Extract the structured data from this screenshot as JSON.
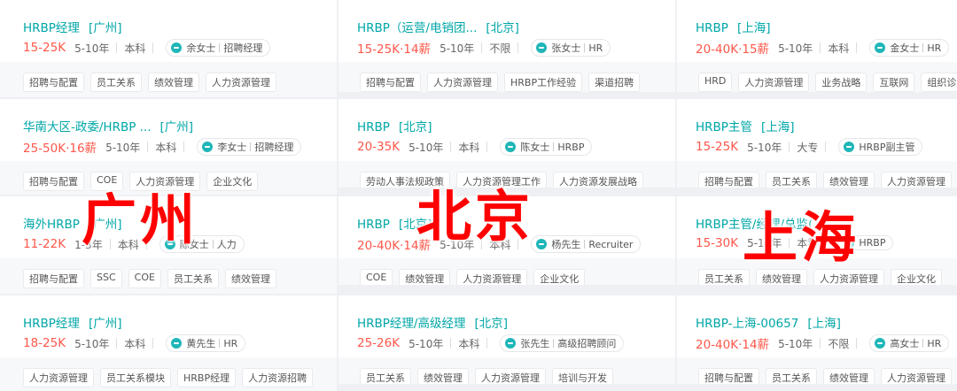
{
  "columns": [
    {
      "cards": [
        {
          "title": "HRBP经理",
          "city": "[广州]",
          "salary": "15-25K",
          "experience": "5-10年",
          "education": "本科",
          "recruiter_name": "余女士",
          "recruiter_role": "招聘经理",
          "tags": [
            "招聘与配置",
            "员工关系",
            "绩效管理",
            "人力资源管理"
          ]
        },
        {
          "title": "华南大区-政委/HRBP ...",
          "city": "[广州]",
          "salary": "25-50K·16薪",
          "experience": "5-10年",
          "education": "本科",
          "recruiter_name": "李女士",
          "recruiter_role": "招聘经理",
          "tags": [
            "招聘与配置",
            "COE",
            "人力资源管理",
            "企业文化"
          ]
        },
        {
          "title": "海外HRBP",
          "city": "[广州]",
          "salary": "11-22K",
          "experience": "1-3年",
          "education": "本科",
          "recruiter_name": "陈女士",
          "recruiter_role": "人力",
          "tags": [
            "招聘与配置",
            "SSC",
            "COE",
            "员工关系",
            "绩效管理"
          ]
        },
        {
          "title": "HRBP经理",
          "city": "[广州]",
          "salary": "18-25K",
          "experience": "5-10年",
          "education": "本科",
          "recruiter_name": "黄先生",
          "recruiter_role": "HR",
          "tags": [
            "人力资源管理",
            "员工关系模块",
            "HRBP经理",
            "人力资源招聘"
          ]
        }
      ]
    },
    {
      "cards": [
        {
          "title": "HRBP（运营/电销团...",
          "city": "[北京]",
          "salary": "15-25K·14薪",
          "experience": "5-10年",
          "education": "不限",
          "recruiter_name": "张女士",
          "recruiter_role": "HR",
          "tags": [
            "招聘与配置",
            "人力资源管理",
            "HRBP工作经验",
            "渠道招聘"
          ]
        },
        {
          "title": "HRBP",
          "city": "[北京]",
          "salary": "20-35K",
          "experience": "5-10年",
          "education": "本科",
          "recruiter_name": "陈女士",
          "recruiter_role": "HRBP",
          "tags": [
            "劳动人事法规政策",
            "人力资源管理工作",
            "人力资源发展战略"
          ]
        },
        {
          "title": "HRBP",
          "city": "[北京]",
          "salary": "20-40K·14薪",
          "experience": "5-10年",
          "education": "本科",
          "recruiter_name": "杨先生",
          "recruiter_role": "Recruiter",
          "tags": [
            "COE",
            "绩效管理",
            "人力资源管理",
            "企业文化"
          ]
        },
        {
          "title": "HRBP经理/高级经理",
          "city": "[北京]",
          "salary": "25-26K",
          "experience": "5-10年",
          "education": "本科",
          "recruiter_name": "张先生",
          "recruiter_role": "高级招聘顾问",
          "tags": [
            "员工关系",
            "绩效管理",
            "人力资源管理",
            "培训与开发"
          ]
        }
      ]
    },
    {
      "cards": [
        {
          "title": "HRBP",
          "city": "[上海]",
          "salary": "20-40K·15薪",
          "experience": "5-10年",
          "education": "本科",
          "recruiter_name": "金女士",
          "recruiter_role": "HR",
          "tags": [
            "HRD",
            "人力资源管理",
            "业务战略",
            "互联网",
            "组织诊断"
          ]
        },
        {
          "title": "HRBP主管",
          "city": "[上海]",
          "salary": "15-25K",
          "experience": "5-10年",
          "education": "大专",
          "recruiter_name": "",
          "recruiter_role": "HRBP副主管",
          "tags": [
            "招聘与配置",
            "员工关系",
            "绩效管理",
            "人力资源管理"
          ]
        },
        {
          "title": "HRBP主管/经理/总监(",
          "city": "",
          "salary": "15-30K",
          "experience": "5-10年",
          "education": "本科",
          "recruiter_name": "",
          "recruiter_role": "HRBP",
          "tags": [
            "员工关系",
            "绩效管理",
            "人力资源管理",
            "企业文化"
          ]
        },
        {
          "title": "HRBP-上海-00657",
          "city": "[上海]",
          "salary": "20-40K·14薪",
          "experience": "5-10年",
          "education": "不限",
          "recruiter_name": "高女士",
          "recruiter_role": "HR",
          "tags": [
            "招聘与配置",
            "员工关系",
            "绩效管理",
            "人力资源管理"
          ]
        }
      ]
    }
  ],
  "watermarks": {
    "guangzhou": "广州",
    "beijing": "北京",
    "shanghai": "上海"
  }
}
